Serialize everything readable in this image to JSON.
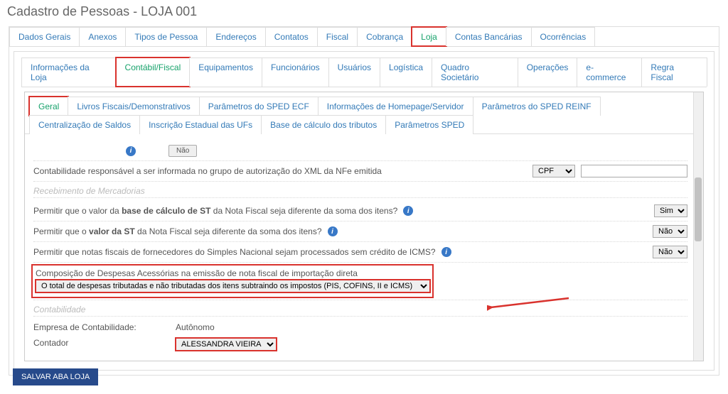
{
  "page_title": "Cadastro de Pessoas - LOJA 001",
  "main_tabs": {
    "t0": "Dados Gerais",
    "t1": "Anexos",
    "t2": "Tipos de Pessoa",
    "t3": "Endereços",
    "t4": "Contatos",
    "t5": "Fiscal",
    "t6": "Cobrança",
    "t7": "Loja",
    "t8": "Contas Bancárias",
    "t9": "Ocorrências"
  },
  "loja_tabs": {
    "s0": "Informações da Loja",
    "s1": "Contábil/Fiscal",
    "s2": "Equipamentos",
    "s3": "Funcionários",
    "s4": "Usuários",
    "s5": "Logística",
    "s6": "Quadro Societário",
    "s7": "Operações",
    "s8": "e-commerce",
    "s9": "Regra Fiscal"
  },
  "cf_tabs": {
    "c0": "Geral",
    "c1": "Livros Fiscais/Demonstrativos",
    "c2": "Parâmetros do SPED ECF",
    "c3": "Informações de Homepage/Servidor",
    "c4": "Parâmetros do SPED REINF",
    "c5": "Centralização de Saldos",
    "c6": "Inscrição Estadual das UFs",
    "c7": "Base de cálculo dos tributos",
    "c8": "Parâmetros SPED"
  },
  "rows": {
    "contab_resp": "Contabilidade responsável a ser informada no grupo de autorização do XML da NFe emitida",
    "cpf_opt": "CPF",
    "sec_receb": "Recebimento de Mercadorias",
    "permitir_bc_st_pre": "Permitir que o valor da ",
    "permitir_bc_st_bold": "base de cálculo de ST",
    "permitir_bc_st_post": " da Nota Fiscal seja diferente da soma dos itens?",
    "permitir_valor_st_pre": "Permitir que o ",
    "permitir_valor_st_bold": "valor da ST",
    "permitir_valor_st_post": " da Nota Fiscal seja diferente da soma dos itens?",
    "permitir_simples": "Permitir que notas fiscais de fornecedores do Simples Nacional sejam processados sem crédito de ICMS?",
    "composicao_title": "Composição de Despesas Acessórias na emissão de nota fiscal de importação direta",
    "composicao_opt": "O total de despesas tributadas e não tributadas dos itens subtraindo os impostos (PIS, COFINS, II e ICMS)",
    "sec_contab": "Contabilidade",
    "empresa_contab_k": "Empresa de Contabilidade:",
    "empresa_contab_v": "Autônomo",
    "contador_k": "Contador",
    "contador_v": "ALESSANDRA VIEIRA",
    "sim": "Sim",
    "nao": "Não"
  },
  "buttons": {
    "save_loja": "SALVAR ABA LOJA"
  }
}
